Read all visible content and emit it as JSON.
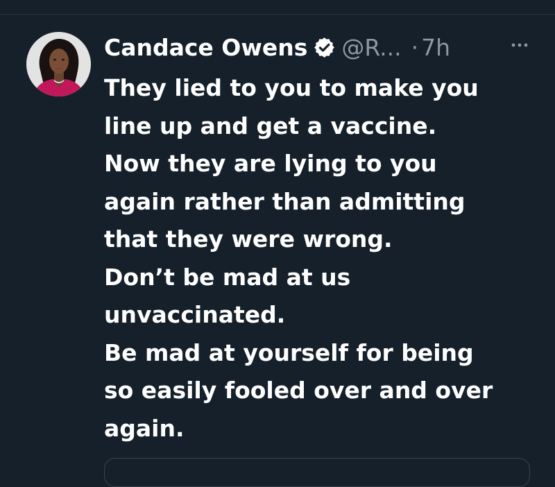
{
  "tweet": {
    "author": {
      "display_name": "Candace Owens",
      "verified": true,
      "verified_icon": "verified-badge-icon",
      "handle": "@R...",
      "separator": "·",
      "time": "7h"
    },
    "more_icon": "more-options-icon",
    "text_lines": [
      "They lied to you to make you",
      "line up and get a vaccine.",
      "Now they are lying to you",
      "again rather than admitting",
      "that they were wrong.",
      "Don’t be mad at us",
      "unvaccinated.",
      "Be mad at yourself for being",
      "so easily fooled over and over",
      "again."
    ]
  },
  "colors": {
    "background": "#15202b",
    "text_primary": "#ffffff",
    "text_secondary": "#8b98a5",
    "border": "#38444d"
  }
}
